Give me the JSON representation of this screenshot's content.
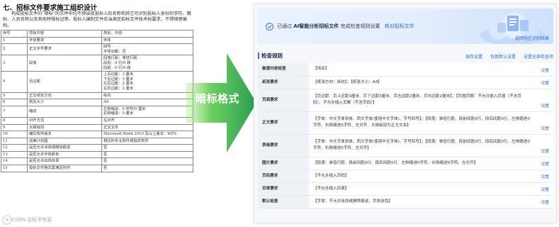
{
  "document": {
    "title": "七、招标文件要求施工组织设计",
    "intro": "构成投标文件的“暗标”的文件中均不得出现投标人的名称和其它可识别投标人身份的字符、徽标、人员名称以及其他特殊标记等。投标人编制文件应当满足招标文件技术标要求，不得随意编制。",
    "table_header": [
      "序号",
      "项目内容",
      "类别、内容"
    ],
    "rows": [
      [
        "1",
        "字体要求",
        "宋体"
      ],
      [
        "2",
        "正文字号要求",
        "四号\n字体加粗：否"
      ],
      [
        "3",
        "段落",
        "段落行距：单倍行距\n段后：0 行/0 磅\n段前：0 行/0 磅"
      ],
      [
        "4",
        "页边距",
        "上页边距：3 厘米\n下页边距：3 厘米\n左页边距：2 厘米\n右页边距：2 厘米"
      ],
      [
        "5",
        "正文纸张方向",
        "纵向"
      ],
      [
        "6",
        "纸张大小",
        "A4"
      ],
      [
        "7",
        "缩进",
        "左侧缩进：0 字符/0 厘米\n右侧缩进：0 厘米"
      ],
      [
        "8",
        "对齐方式",
        "左对齐"
      ],
      [
        "9",
        "大纲级别",
        "正文文本"
      ],
      [
        "10",
        "编写软件版本",
        "Microsoft Word 2010 及以上版本、WPS"
      ],
      [
        "11",
        "进度计划图",
        "相应的专业软件或指定软件"
      ],
      [
        "12",
        "是否允许涂改或删除痕迹",
        "否"
      ],
      [
        "13",
        "是否允许字体颜色",
        "否"
      ],
      [
        "14",
        "是否允许出现目录",
        "否"
      ],
      [
        "15",
        "投标文件格式需满足附件",
        "否"
      ]
    ]
  },
  "arrow_label": "暗标格式",
  "app": {
    "banner": {
      "prefix": "已通过",
      "product": "AI智能分析招标文件",
      "suffix": "完成检查规则设置",
      "link": "核对招标文件",
      "back": "返回电区识别结果"
    },
    "section": {
      "title": "检查规则",
      "actions": [
        "保存设置",
        "恢复默认设置",
        "设置全部检查项"
      ]
    },
    "setting_label": "设置",
    "rules": [
      {
        "key": "敏感内容检查",
        "value": "【地名】"
      },
      {
        "key": "纸张要求",
        "value": "【纸张方向：纵向】；【纸张大小：A4】"
      },
      {
        "key": "页面要求",
        "value": "【页边距：页上边距3厘米、页下边距3厘米、页左边距2厘米、页右边距2厘米】；【页眉页脚：不允许插入页眉（不含页码）、不允许插入页脚（不含页码）】"
      },
      {
        "key": "正文要求",
        "value": "【字体：中文字体宋体、西文字体(使用中文字体)、字号四号】；【段落：单倍行距、段前间距0行、段后间距0行、左侧缩进0字符、右侧缩进0字符、左对齐、大纲级别为正文文本】"
      },
      {
        "key": "表格要求",
        "value": "【字体：中文字体宋体、西文字体(使用中文字体)、字号四号】；【段落：单倍行距、段前间距0行、段后间距0行、左侧缩进0字符、右侧缩进0字符、左对齐】"
      },
      {
        "key": "图片要求",
        "value": "【段落：单倍行距、段前间距0行、段后间距0行、左侧缩进0字符、右侧缩进0字符、左对齐】"
      },
      {
        "key": "页码要求",
        "value": "【不允许插入页码】"
      },
      {
        "key": "目录要求",
        "value": "【不允许插入目录】"
      },
      {
        "key": "默认检查",
        "value": "【字体：不允许涂改或删除痕迹、字体涂色】"
      }
    ]
  },
  "watermark": "CSDN @标书专家",
  "colors": {
    "accent": "#2e6fe0",
    "arrow_start": "#7ddc6a",
    "arrow_end": "#2a9d52",
    "key_bg": "#eef1f5"
  },
  "icons": {
    "banner_status": "check-circle-icon",
    "banner_art": "cloud-document-illustration",
    "arrow": "right-arrow-shape"
  }
}
